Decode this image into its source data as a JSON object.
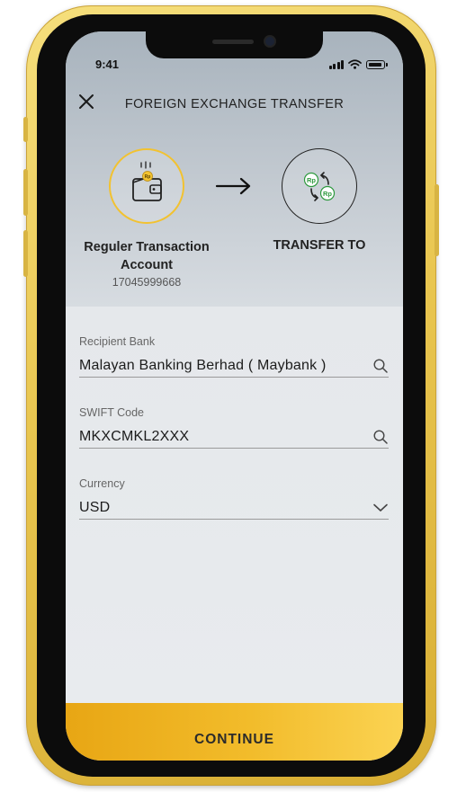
{
  "status_bar": {
    "time": "9:41"
  },
  "header": {
    "title": "FOREIGN EXCHANGE TRANSFER"
  },
  "transfer_from": {
    "label": "Reguler Transaction Account",
    "account_number": "17045999668",
    "coin_text": "Rp"
  },
  "transfer_to": {
    "label": "TRANSFER TO",
    "coin_text_1": "Rp",
    "coin_text_2": "Rp"
  },
  "form": {
    "recipient_bank": {
      "label": "Recipient Bank",
      "value": "Malayan Banking Berhad ( Maybank )"
    },
    "swift_code": {
      "label": "SWIFT Code",
      "value": "MKXCMKL2XXX"
    },
    "currency": {
      "label": "Currency",
      "value": "USD"
    }
  },
  "continue_button": {
    "label": "CONTINUE"
  },
  "colors": {
    "accent": "#f2c230",
    "button_start": "#e8a614",
    "button_end": "#fbd352",
    "coin_green": "#2e9a3e"
  }
}
